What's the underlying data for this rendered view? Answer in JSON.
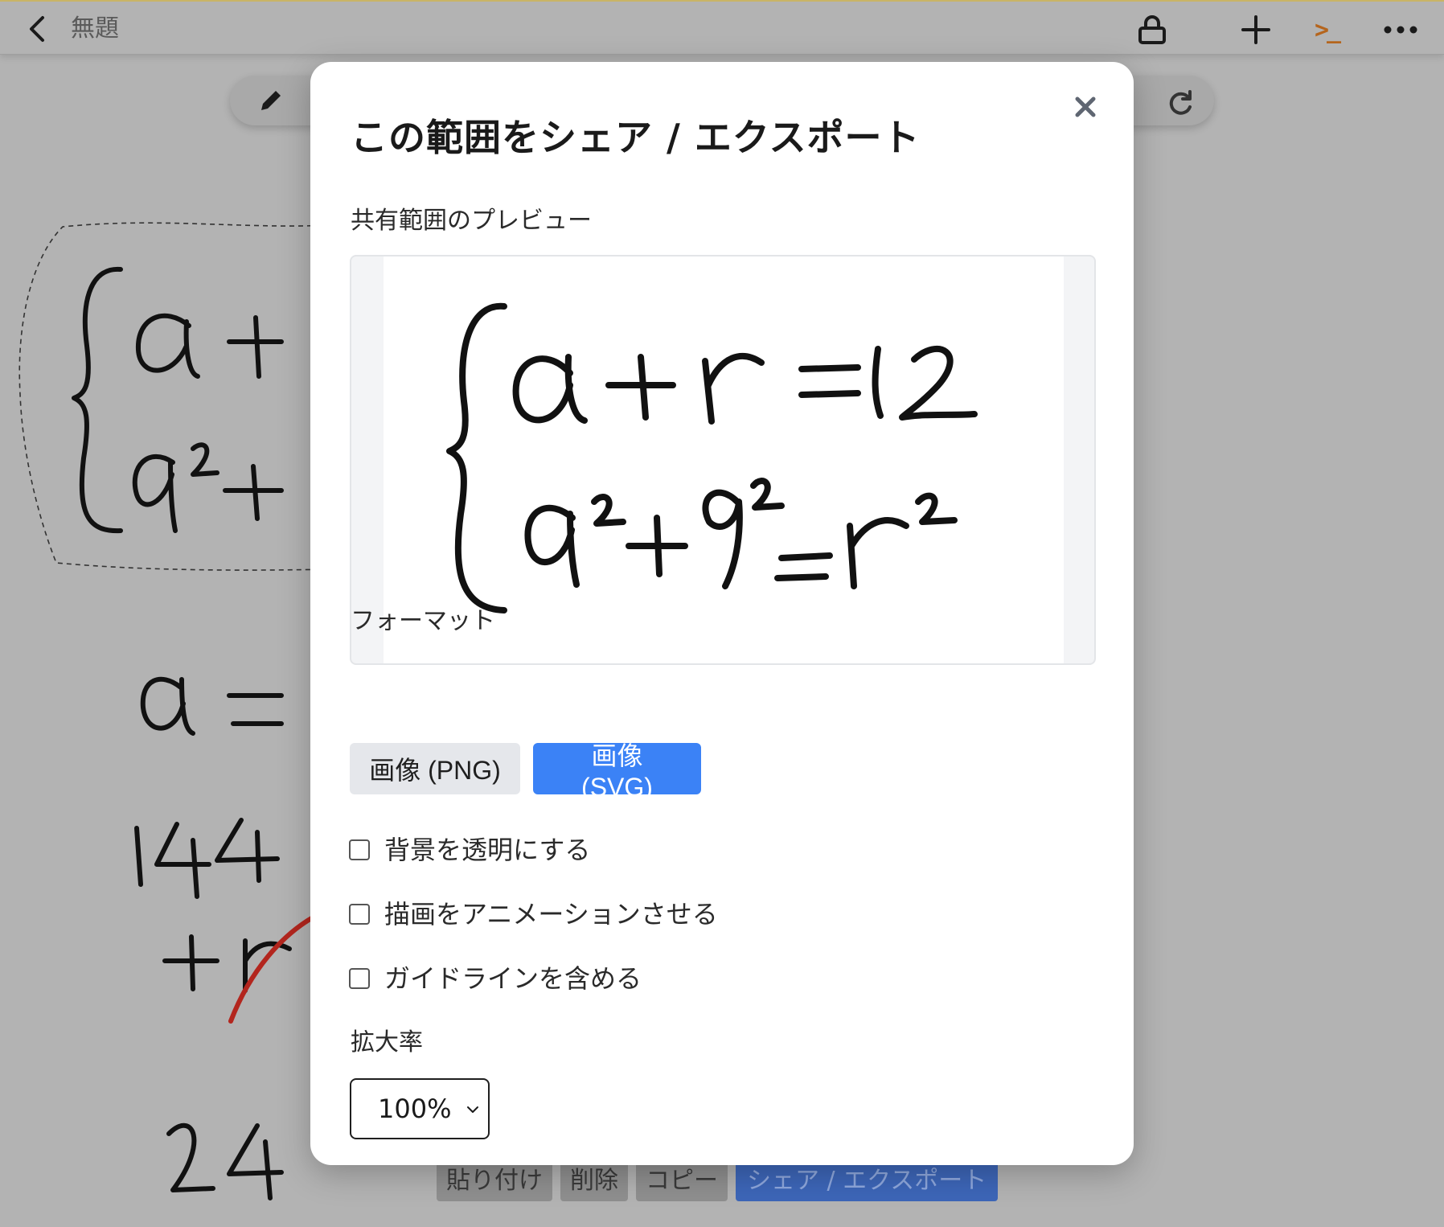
{
  "header": {
    "title": "無題",
    "terminal_label": ">_",
    "icons": [
      "chevron-left-icon",
      "lock-icon",
      "plus-icon",
      "terminal-icon",
      "more-horizontal-icon"
    ]
  },
  "canvas": {
    "selection_actions": [
      "貼り付け",
      "削除",
      "コピー",
      "シェア / エクスポート"
    ],
    "icons": [
      "pencil-icon",
      "redo-icon"
    ]
  },
  "modal": {
    "title": "この範囲をシェア / エクスポート",
    "preview_label": "共有範囲のプレビュー",
    "format_label": "フォーマット",
    "formats": [
      {
        "label": "画像 (PNG)",
        "selected": false
      },
      {
        "label": "画像 (SVG)",
        "selected": true
      }
    ],
    "options": [
      {
        "label": "背景を透明にする",
        "checked": false
      },
      {
        "label": "描画をアニメーションさせる",
        "checked": false
      },
      {
        "label": "ガイドラインを含める",
        "checked": false
      }
    ],
    "zoom_label": "拡大率",
    "zoom_value": "100%",
    "close_icon": "close-icon"
  },
  "colors": {
    "accent": "#3b82f6",
    "overlay": "#b3b3b3",
    "terminal": "#b5651d",
    "annotation_red": "#b3261e"
  }
}
